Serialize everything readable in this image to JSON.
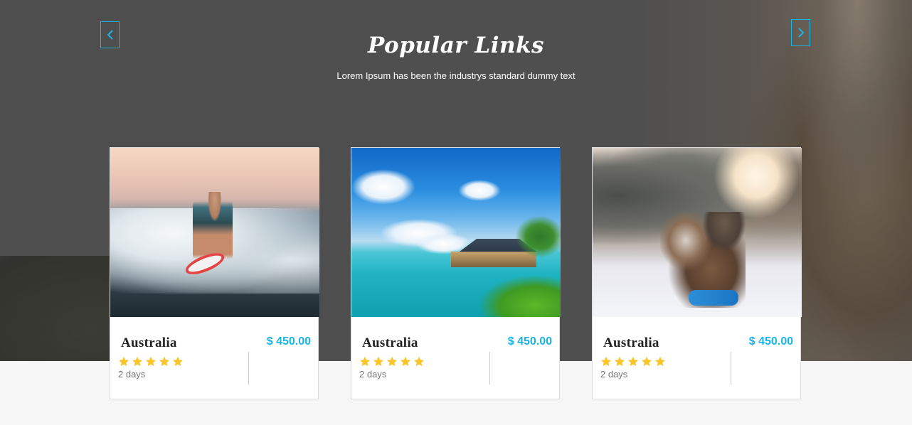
{
  "header": {
    "title": "Popular Links",
    "subtitle": "Lorem Ipsum has been the industrys standard dummy text"
  },
  "carousel": {
    "prev_icon": "chevron-left-icon",
    "next_icon": "chevron-right-icon"
  },
  "colors": {
    "accent": "#19b5e8",
    "star": "#f9c52b",
    "hero_bg": "#4f4f4f",
    "page_bg": "#f6f6f6"
  },
  "cards": [
    {
      "image": "surfer-photo",
      "name": "Australia",
      "price": "$ 450.00",
      "rating": 5,
      "duration": "2 days"
    },
    {
      "image": "tropical-resort-photo",
      "name": "Australia",
      "price": "$ 450.00",
      "rating": 5,
      "duration": "2 days"
    },
    {
      "image": "snow-family-photo",
      "name": "Australia",
      "price": "$ 450.00",
      "rating": 5,
      "duration": "2 days"
    }
  ]
}
